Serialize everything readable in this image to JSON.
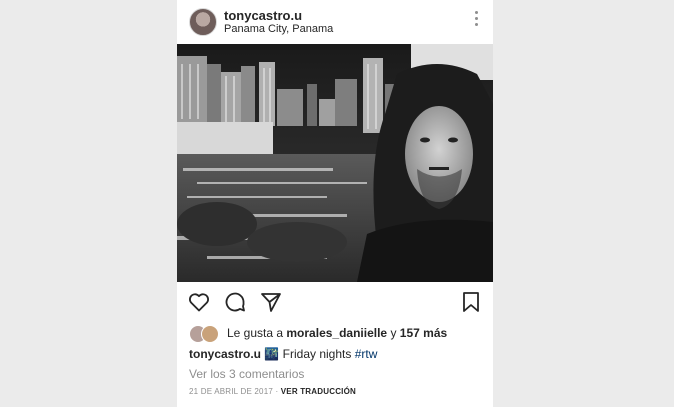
{
  "post": {
    "username": "tonycastro.u",
    "location": "Panama City, Panama",
    "likes": {
      "prefix": "Le gusta a",
      "user": "morales_daniielle",
      "connector": "y",
      "count_text": "157 más"
    },
    "caption": {
      "username": "tonycastro.u",
      "emoji": "🌃",
      "text": "Friday nights",
      "hashtag": "#rtw"
    },
    "comments_link": "Ver los 3 comentarios",
    "date": "21 DE ABRIL DE 2017",
    "separator": "·",
    "translate_label": "VER TRADUCCIÓN"
  },
  "icons": {
    "more": "more-options-icon",
    "like": "heart-icon",
    "comment": "comment-icon",
    "share": "share-icon",
    "save": "bookmark-icon"
  },
  "colors": {
    "text": "#262626",
    "secondary": "#8e8e8e",
    "hashtag": "#003569"
  }
}
